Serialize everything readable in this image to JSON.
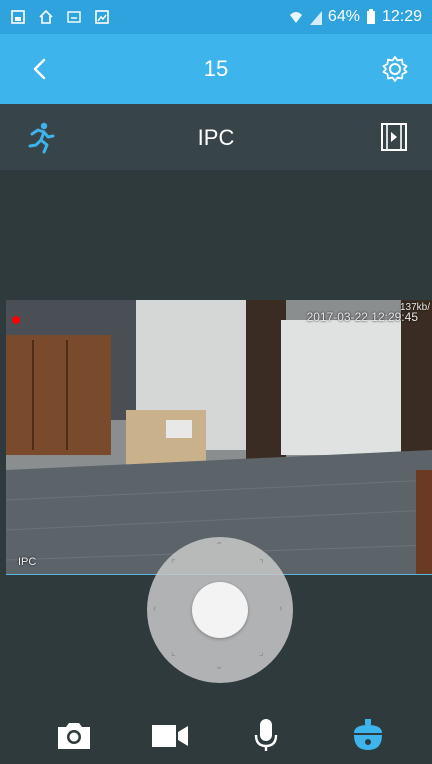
{
  "status_bar": {
    "battery": "64%",
    "time": "12:29",
    "icons": [
      "gallery-icon",
      "home-icon",
      "cast-icon",
      "photo-icon"
    ]
  },
  "header": {
    "title": "15",
    "back_icon": "chevron-left-icon",
    "settings_icon": "gear-icon"
  },
  "sub_header": {
    "label": "IPC",
    "motion_icon": "running-person-icon",
    "playback_icon": "film-play-icon"
  },
  "video": {
    "timestamp": "2017-03-22 12:29:45",
    "bitrate": "137kb/",
    "channel_label": "IPC"
  },
  "toolbar": {
    "items": [
      "camera-icon",
      "video-record-icon",
      "microphone-icon",
      "ptz-dome-icon"
    ]
  },
  "colors": {
    "status_bar": "#2ea3dd",
    "header": "#3db4ec",
    "sub_header": "#37454a",
    "background": "#2f3a3d",
    "accent": "#3db4ec"
  }
}
